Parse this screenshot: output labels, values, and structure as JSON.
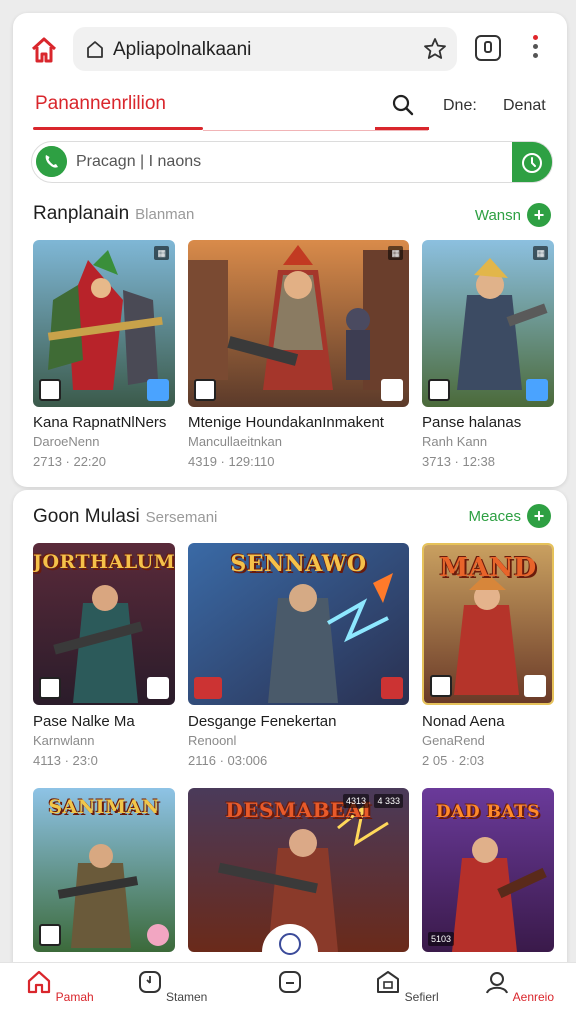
{
  "browser": {
    "url": "Apliapolnalkaani"
  },
  "nav": {
    "title": "Panannenrlilion",
    "link1": "Dne:",
    "link2": "Denat"
  },
  "phone": {
    "text": "Pracagn  |  I naons"
  },
  "section1": {
    "title": "Ranplanain",
    "subtitle": "Blanman",
    "more": "Wansn",
    "games": [
      {
        "title": "Kana RapnatNlNers",
        "sub": "DaroeNenn",
        "meta": "2713 · 22:20"
      },
      {
        "title": "Mtenige HoundakanInmakent",
        "sub": "Mancullaeitnkan",
        "meta": "4319 · 129:110"
      },
      {
        "title": "Panse halanas",
        "sub": "Ranh Kann",
        "meta": "3713 · 12:38"
      }
    ]
  },
  "section2": {
    "title": "Goon Mulasi",
    "subtitle": "Sersemani",
    "more": "Meaces",
    "games": [
      {
        "title": "Pase Nalke Ma",
        "sub": "Karnwlann",
        "meta": "4113 · 23:0",
        "art": "JORTHALUM"
      },
      {
        "title": "Desgange Fenekertan",
        "sub": "Renoonl",
        "meta": "2116 · 03:006",
        "art": "SENNAWO"
      },
      {
        "title": "Nonad Aena",
        "sub": "GenaRend",
        "meta": "2 05 · 2:03",
        "art": "MAND"
      }
    ],
    "games_row2": [
      {
        "art": "SANIMAN"
      },
      {
        "art": "DESMABEAI",
        "badge1": "4313",
        "badge2": "4 333"
      },
      {
        "art": "DAD BATS",
        "badge": "5103"
      }
    ]
  },
  "bottom_nav": {
    "home": "Pamah",
    "stories": "Stamen",
    "search": "Sefierl",
    "account": "Aenreio"
  },
  "colors": {
    "accent": "#d9262c",
    "green": "#2ea043"
  }
}
